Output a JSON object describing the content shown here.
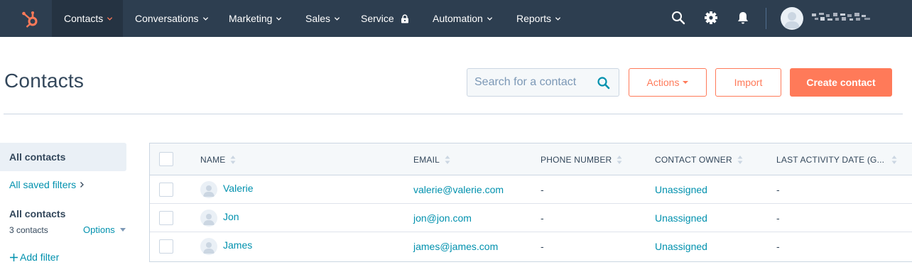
{
  "nav": {
    "items": [
      {
        "label": "Contacts",
        "active": true
      },
      {
        "label": "Conversations"
      },
      {
        "label": "Marketing"
      },
      {
        "label": "Sales"
      },
      {
        "label": "Service",
        "icon": "lock-icon"
      },
      {
        "label": "Automation"
      },
      {
        "label": "Reports"
      }
    ],
    "icons": [
      "search-icon",
      "gear-icon",
      "bell-icon"
    ]
  },
  "page": {
    "title": "Contacts"
  },
  "search": {
    "placeholder": "Search for a contact"
  },
  "buttons": {
    "actions": "Actions",
    "import": "Import",
    "create": "Create contact"
  },
  "sidebar": {
    "all_contacts": "All contacts",
    "saved_filters": "All saved filters",
    "view_name": "All contacts",
    "count": "3 contacts",
    "options": "Options",
    "add_filter": "Add filter"
  },
  "table": {
    "columns": [
      "NAME",
      "EMAIL",
      "PHONE NUMBER",
      "CONTACT OWNER",
      "LAST ACTIVITY DATE (G..."
    ],
    "rows": [
      {
        "name": "Valerie",
        "email": "valerie@valerie.com",
        "phone": "-",
        "owner": "Unassigned",
        "last_activity": "-"
      },
      {
        "name": "Jon",
        "email": "jon@jon.com",
        "phone": "-",
        "owner": "Unassigned",
        "last_activity": "-"
      },
      {
        "name": "James",
        "email": "james@james.com",
        "phone": "-",
        "owner": "Unassigned",
        "last_activity": "-"
      }
    ]
  },
  "colors": {
    "nav_bg": "#2d3e50",
    "accent": "#ff7a59",
    "link": "#0091ae",
    "text": "#33475b"
  }
}
